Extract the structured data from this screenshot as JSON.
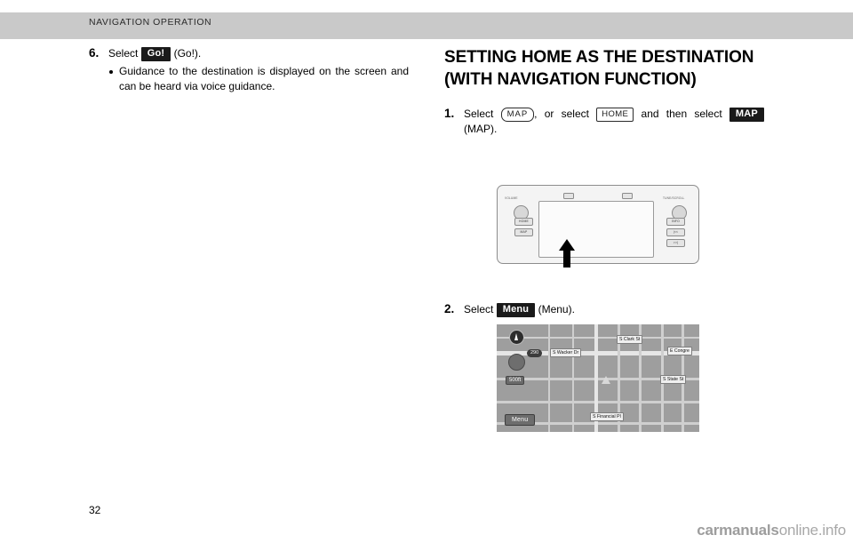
{
  "header": {
    "title": "NAVIGATION OPERATION"
  },
  "left_column": {
    "step6": {
      "number": "6.",
      "text_before": "Select",
      "key_label": "Go!",
      "text_after": "(Go!).",
      "bullets": [
        "Guidance to the destination is displayed on the screen and can be heard via voice guidance."
      ]
    }
  },
  "right_column": {
    "section_title": "SETTING HOME AS THE DESTINATION (WITH NAVIGATION FUNCTION)",
    "step1": {
      "number": "1.",
      "text_before": "Select",
      "key_map_outline": "MAP",
      "text_mid1": ", or select",
      "key_home_outline": "HOME",
      "text_mid2": "and then select",
      "key_map_dark": "MAP",
      "text_after": "(MAP)."
    },
    "step2": {
      "number": "2.",
      "text_before": "Select",
      "key_label": "Menu",
      "text_after": "(Menu)."
    }
  },
  "head_unit": {
    "labels": {
      "volume": "VOLUME",
      "tune": "TUNE/SCROLL",
      "home": "HOME",
      "map": "MAP",
      "info": "INFO",
      "seek_prev": "|<<",
      "seek_next": ">>|"
    }
  },
  "map_illustration": {
    "menu_button": "Menu",
    "scale": "500ft",
    "highway_badge": "290",
    "street_labels": [
      "S Clark St",
      "E Congre",
      "S Wacker Dr",
      "S State St",
      "S Financial Pl"
    ]
  },
  "footer": {
    "page_number": "32",
    "watermark_prefix": "carmanuals",
    "watermark_suffix": "online.info"
  }
}
